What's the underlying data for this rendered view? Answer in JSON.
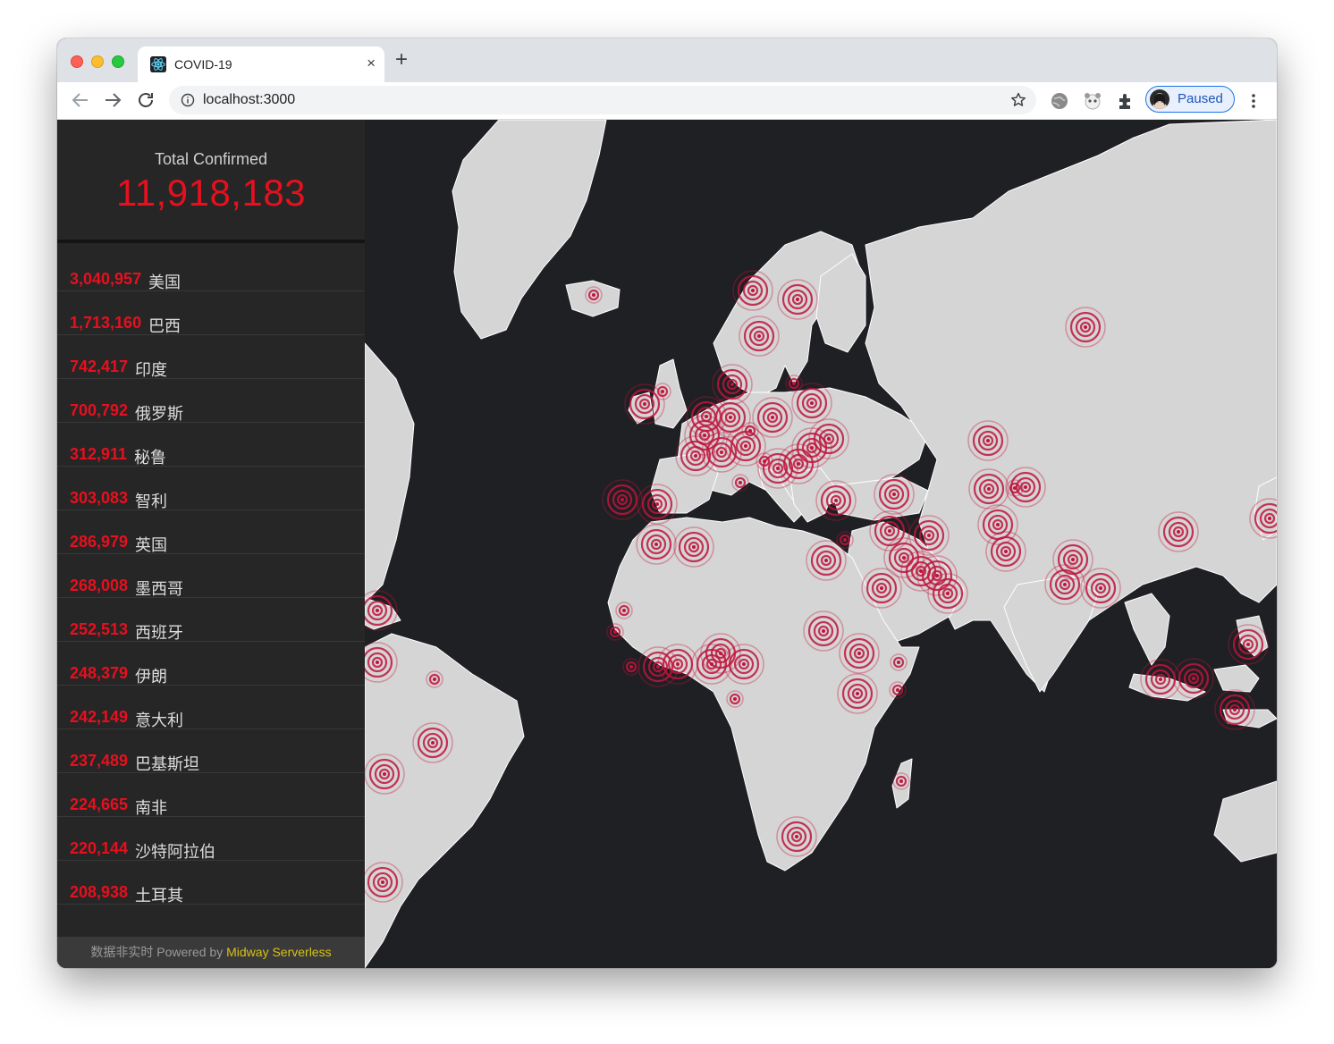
{
  "browser": {
    "tab_title": "COVID-19",
    "new_tab": "+",
    "close": "×",
    "url": "localhost:3000",
    "profile_label": "Paused",
    "accent": "#1a73e8"
  },
  "summary": {
    "label": "Total Confirmed",
    "value": "11,918,183",
    "color": "#e6101e"
  },
  "countries": [
    {
      "count": "3,040,957",
      "name": "美国"
    },
    {
      "count": "1,713,160",
      "name": "巴西"
    },
    {
      "count": "742,417",
      "name": "印度"
    },
    {
      "count": "700,792",
      "name": "俄罗斯"
    },
    {
      "count": "312,911",
      "name": "秘鲁"
    },
    {
      "count": "303,083",
      "name": "智利"
    },
    {
      "count": "286,979",
      "name": "英国"
    },
    {
      "count": "268,008",
      "name": "墨西哥"
    },
    {
      "count": "252,513",
      "name": "西班牙"
    },
    {
      "count": "248,379",
      "name": "伊朗"
    },
    {
      "count": "242,149",
      "name": "意大利"
    },
    {
      "count": "237,489",
      "name": "巴基斯坦"
    },
    {
      "count": "224,665",
      "name": "南非"
    },
    {
      "count": "220,144",
      "name": "沙特阿拉伯"
    },
    {
      "count": "208,938",
      "name": "土耳其"
    }
  ],
  "footer": {
    "text": "数据非实时 Powered by ",
    "brand": "Midway Serverless"
  },
  "map": {
    "land_color": "#d5d5d5",
    "ocean_color": "#1f2024",
    "marker_color": "#c0143c",
    "icons": [
      "back-icon",
      "forward-icon",
      "reload-icon",
      "info-icon",
      "star-icon",
      "extension-icon",
      "menu-icon"
    ]
  }
}
